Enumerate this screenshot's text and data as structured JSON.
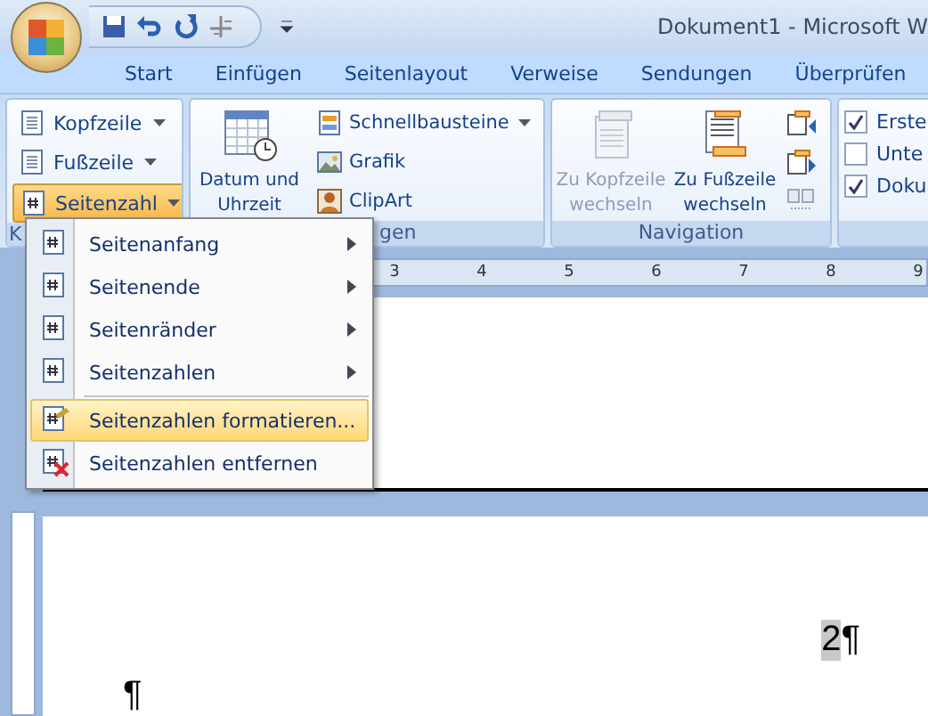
{
  "window": {
    "title": "Dokument1 - Microsoft W"
  },
  "tabs": [
    {
      "label": "Start",
      "selected": false
    },
    {
      "label": "Einfügen",
      "selected": false
    },
    {
      "label": "Seitenlayout",
      "selected": false
    },
    {
      "label": "Verweise",
      "selected": false
    },
    {
      "label": "Sendungen",
      "selected": false
    },
    {
      "label": "Überprüfen",
      "selected": false
    }
  ],
  "ribbon": {
    "groups": [
      {
        "label": "K",
        "items": [
          {
            "kind": "small",
            "label": "Kopfzeile",
            "dropdown": true,
            "pressed": false
          },
          {
            "kind": "small",
            "label": "Fußzeile",
            "dropdown": true,
            "pressed": false
          },
          {
            "kind": "small",
            "label": "Seitenzahl",
            "dropdown": true,
            "pressed": true
          }
        ]
      },
      {
        "label": "gen",
        "items": [
          {
            "kind": "large",
            "label": "Datum und Uhrzeit",
            "disabled": false
          },
          {
            "kind": "stack",
            "items": [
              {
                "label": "Schnellbausteine",
                "dropdown": true
              },
              {
                "label": "Grafik",
                "dropdown": false
              },
              {
                "label": "ClipArt",
                "dropdown": false
              }
            ]
          }
        ]
      },
      {
        "label": "Navigation",
        "items": [
          {
            "kind": "large",
            "label": "Zu Kopfzeile wechseln",
            "disabled": true
          },
          {
            "kind": "large",
            "label": "Zu Fußzeile wechseln",
            "disabled": false
          },
          {
            "kind": "icons"
          }
        ]
      },
      {
        "items": [
          {
            "kind": "checks",
            "items": [
              {
                "label": "Erste",
                "checked": true
              },
              {
                "label": "Unte",
                "checked": false
              },
              {
                "label": "Doku",
                "checked": true
              }
            ]
          }
        ]
      }
    ]
  },
  "ruler": {
    "numbers": [
      "3",
      "4",
      "5",
      "6",
      "7",
      "8",
      "9"
    ]
  },
  "menu": {
    "items": [
      {
        "label": "Seitenanfang",
        "submenu": true,
        "selected": false
      },
      {
        "label": "Seitenende",
        "submenu": true,
        "selected": false
      },
      {
        "label": "Seitenränder",
        "submenu": true,
        "selected": false
      },
      {
        "label": "Seitenzahlen",
        "submenu": true,
        "selected": false
      },
      {
        "label": "Seitenzahlen formatieren...",
        "submenu": false,
        "selected": true
      },
      {
        "label": "Seitenzahlen entfernen",
        "submenu": false,
        "selected": false
      }
    ]
  },
  "document": {
    "page_number": "2",
    "mark_after_number": "¶",
    "paragraph_mark": "¶"
  }
}
